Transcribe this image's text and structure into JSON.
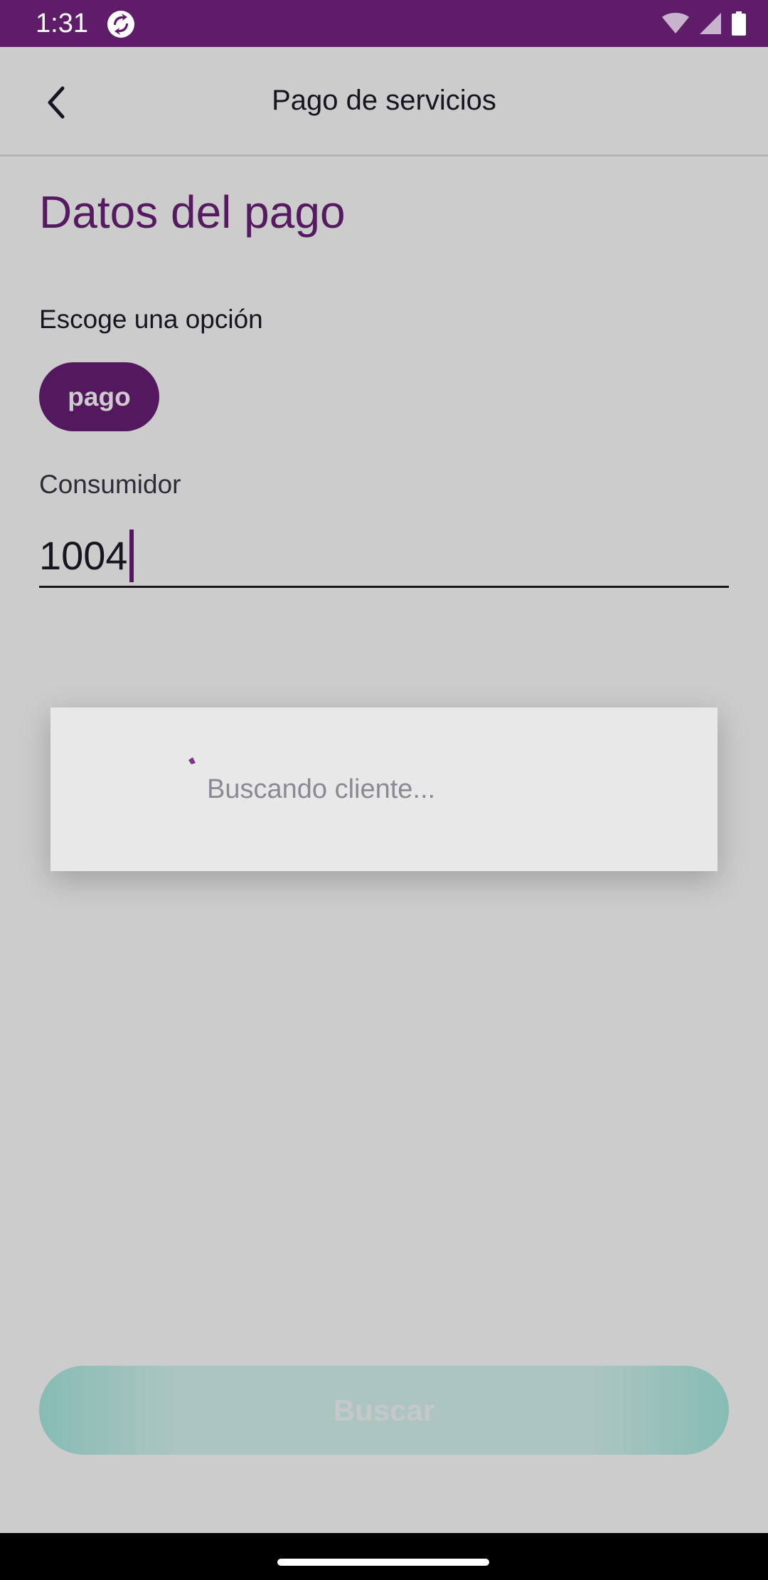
{
  "status_bar": {
    "time": "1:31",
    "app_icon": "sync-icon",
    "icons": [
      "wifi-icon",
      "signal-icon",
      "battery-icon"
    ]
  },
  "app_bar": {
    "title": "Pago de servicios",
    "back_icon": "chevron-left-icon"
  },
  "form": {
    "section_title": "Datos del pago",
    "option_label": "Escoge una opción",
    "option_chip": "pago",
    "consumer_label": "Consumidor",
    "consumer_value": "1004"
  },
  "actions": {
    "search_label": "Buscar"
  },
  "dialog": {
    "message": "Buscando cliente..."
  },
  "colors": {
    "brand": "#6a1f77",
    "status_bar": "#5f1c69",
    "button_teal": "#a8ece2"
  }
}
